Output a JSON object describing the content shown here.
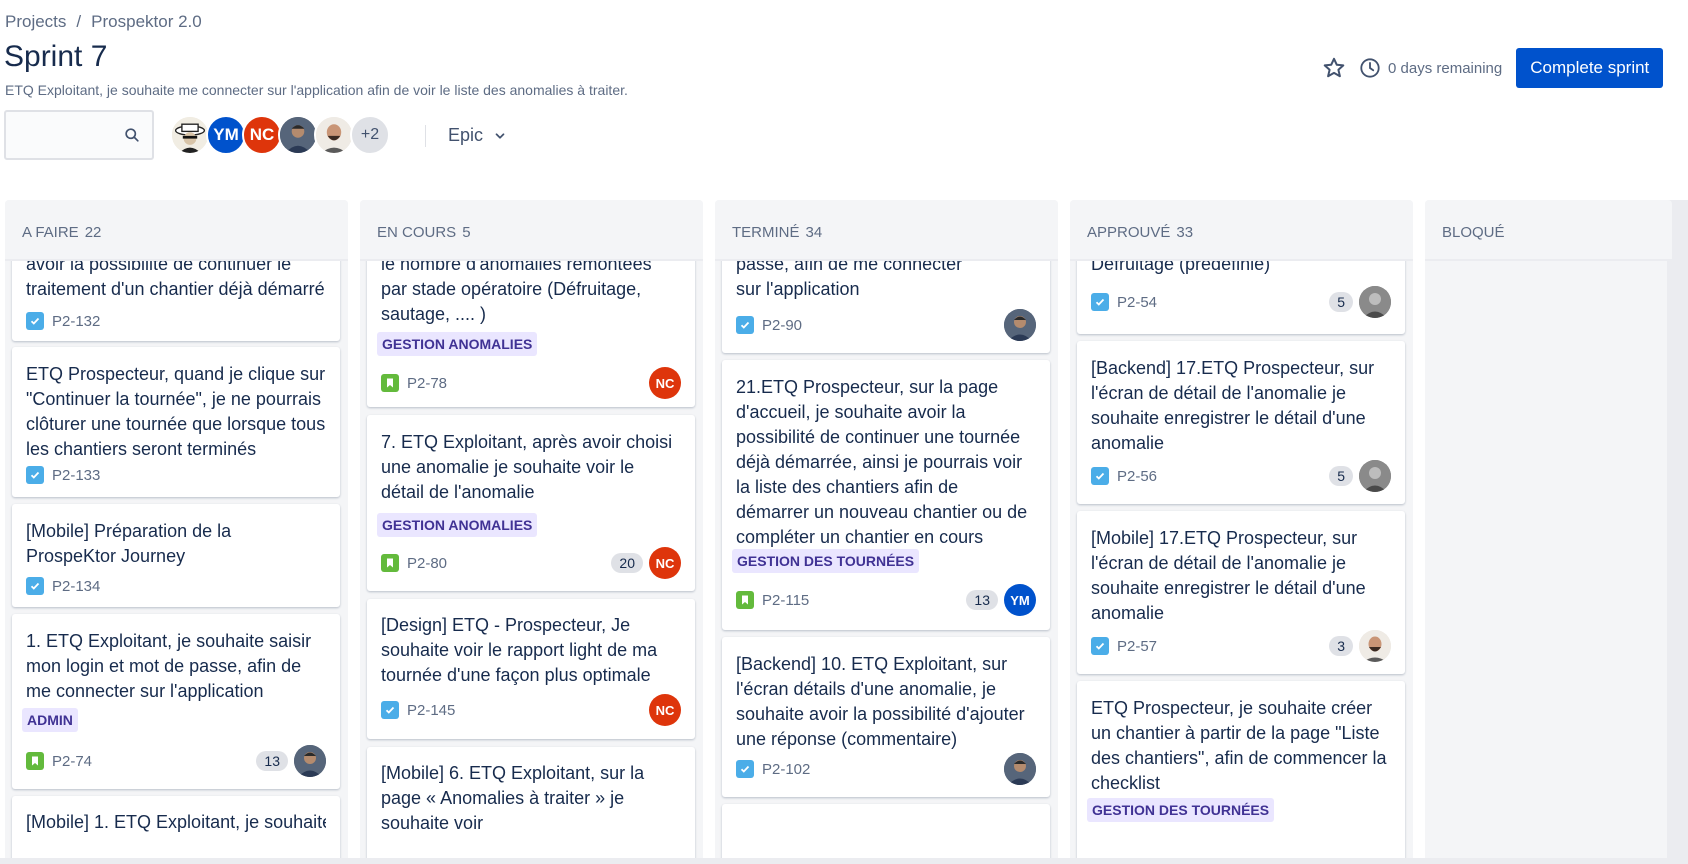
{
  "breadcrumb": {
    "items": [
      "Projects",
      "Prospektor 2.0"
    ],
    "separator": "/"
  },
  "sprint": {
    "title": "Sprint 7",
    "description": "ETQ Exploitant, je souhaite me connecter sur l'application afin de voir le liste des anomalies à traiter."
  },
  "header": {
    "days_remaining": "0 days remaining",
    "complete_button": "Complete sprint"
  },
  "filters": {
    "search_value": "",
    "avatars": [
      {
        "type": "photo-hat"
      },
      {
        "type": "initials",
        "text": "YM",
        "color": "#0052cc"
      },
      {
        "type": "initials",
        "text": "NC",
        "color": "#de350b"
      },
      {
        "type": "photo"
      },
      {
        "type": "photo-bald"
      },
      {
        "type": "more",
        "text": "+2"
      }
    ],
    "epic_label": "Epic"
  },
  "columns": [
    {
      "name": "A FAIRE",
      "count": "22",
      "cards": [
        {
          "summary": "avoir la possibilité de continuer le traitement d'un chantier déjà démarré",
          "key": "P2-132",
          "type": "task"
        },
        {
          "summary": "ETQ Prospecteur, quand je clique sur \"Continuer la tournée\", je ne pourrais clôturer une tournée que lorsque tous les chantiers seront terminés",
          "key": "P2-133",
          "type": "task"
        },
        {
          "summary": "[Mobile] Préparation de la ProspeKtor Journey",
          "key": "P2-134",
          "type": "task"
        },
        {
          "summary": "1. ETQ Exploitant, je souhaite saisir mon login et mot de passe, afin de me connecter sur l'application",
          "key": "P2-74",
          "type": "story",
          "label": "ADMIN",
          "estimate": "13",
          "assignee": "photo"
        },
        {
          "summary": "[Mobile] 1. ETQ Exploitant, je souhaite",
          "key": "",
          "type": "task"
        }
      ]
    },
    {
      "name": "EN COURS",
      "count": "5",
      "cards": [
        {
          "summary": "le nombre d'anomalies remontées par stade opératoire (Défruitage, sautage, .... )",
          "key": "P2-78",
          "type": "story",
          "label": "GESTION ANOMALIES",
          "assignee": "NC"
        },
        {
          "summary": "7. ETQ Exploitant, après avoir choisi une anomalie je souhaite voir le détail de l'anomalie",
          "key": "P2-80",
          "type": "story",
          "label": "GESTION ANOMALIES",
          "estimate": "20",
          "assignee": "NC"
        },
        {
          "summary": "[Design] ETQ - Prospecteur, Je souhaite voir le rapport light de ma tournée d'une façon plus optimale",
          "key": "P2-145",
          "type": "task",
          "assignee": "NC"
        },
        {
          "summary": "[Mobile] 6. ETQ Exploitant, sur la page « Anomalies à traiter » je souhaite voir",
          "key": "",
          "type": "task"
        }
      ]
    },
    {
      "name": "TERMINÉ",
      "count": "34",
      "cards": [
        {
          "summary": "passe, afin de me connecter sur l'application",
          "key": "P2-90",
          "type": "task",
          "assignee": "photo"
        },
        {
          "summary": "21.ETQ Prospecteur, sur la page d'accueil, je souhaite avoir la possibilité de continuer une tournée déjà démarrée, ainsi je pourrais voir la liste des chantiers afin de démarrer un nouveau chantier ou de compléter un chantier en cours",
          "key": "P2-115",
          "type": "story",
          "label": "GESTION DES TOURNÉES",
          "estimate": "13",
          "assignee": "YM"
        },
        {
          "summary": "[Backend] 10. ETQ Exploitant, sur l'écran détails d'une anomalie, je souhaite avoir la possibilité d'ajouter une réponse (commentaire)",
          "key": "P2-102",
          "type": "task",
          "assignee": "photo"
        }
      ]
    },
    {
      "name": "APPROUVÉ",
      "count": "33",
      "cards": [
        {
          "summary": "Défruitage (prédéfinie)",
          "key": "P2-54",
          "type": "task",
          "estimate": "5",
          "assignee": "photo-gray"
        },
        {
          "summary": "[Backend] 17.ETQ Prospecteur, sur l'écran de détail de l'anomalie je souhaite enregistrer le détail d'une anomalie",
          "key": "P2-56",
          "type": "task",
          "estimate": "5",
          "assignee": "photo-gray"
        },
        {
          "summary": "[Mobile] 17.ETQ Prospecteur, sur l'écran de détail de l'anomalie je souhaite enregistrer le détail d'une anomalie",
          "key": "P2-57",
          "type": "task",
          "estimate": "3",
          "assignee": "photo-bald"
        },
        {
          "summary": "ETQ Prospecteur, je souhaite créer un chantier à partir de la page \"Liste des chantiers\", afin de commencer la checklist",
          "key": "",
          "type": "task",
          "label": "GESTION DES TOURNÉES"
        }
      ]
    },
    {
      "name": "BLOQUÉ",
      "count": "",
      "cards": []
    }
  ]
}
